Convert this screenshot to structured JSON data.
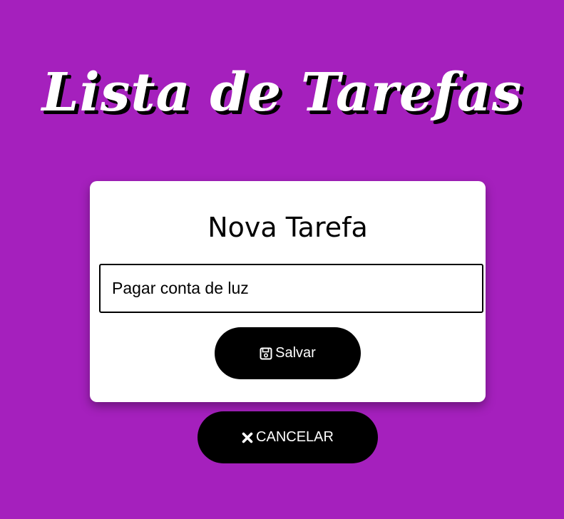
{
  "header": {
    "title": "Lista de Tarefas"
  },
  "form": {
    "heading": "Nova Tarefa",
    "task_input_value": "Pagar conta de luz",
    "save_label": "Salvar",
    "save_icon": "floppy-disk-icon"
  },
  "actions": {
    "cancel_label": "CANCELAR",
    "cancel_icon": "close-icon"
  },
  "colors": {
    "background": "#a520bd",
    "card": "#ffffff",
    "button": "#000000",
    "button_text": "#ffffff"
  }
}
